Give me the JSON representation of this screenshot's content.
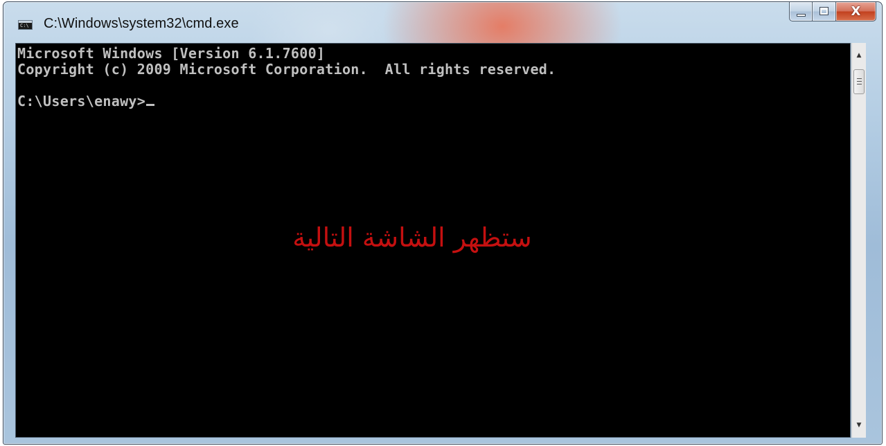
{
  "window": {
    "title": "C:\\Windows\\system32\\cmd.exe",
    "icon": "cmd-icon",
    "icon_text": "C:\\",
    "buttons": {
      "minimize": "minimize-icon",
      "maximize": "maximize-icon",
      "close": "close-icon",
      "close_glyph": "X"
    }
  },
  "console": {
    "lines": [
      "Microsoft Windows [Version 6.1.7600]",
      "Copyright (c) 2009 Microsoft Corporation.  All rights reserved.",
      "",
      "C:\\Users\\enawy>"
    ],
    "overlay": "ستظهر الشاشة التالية",
    "background": "#000000",
    "text_color": "#c0c0c0",
    "overlay_color": "#c41010"
  },
  "scrollbar": {
    "up": "▲",
    "down": "▼"
  }
}
